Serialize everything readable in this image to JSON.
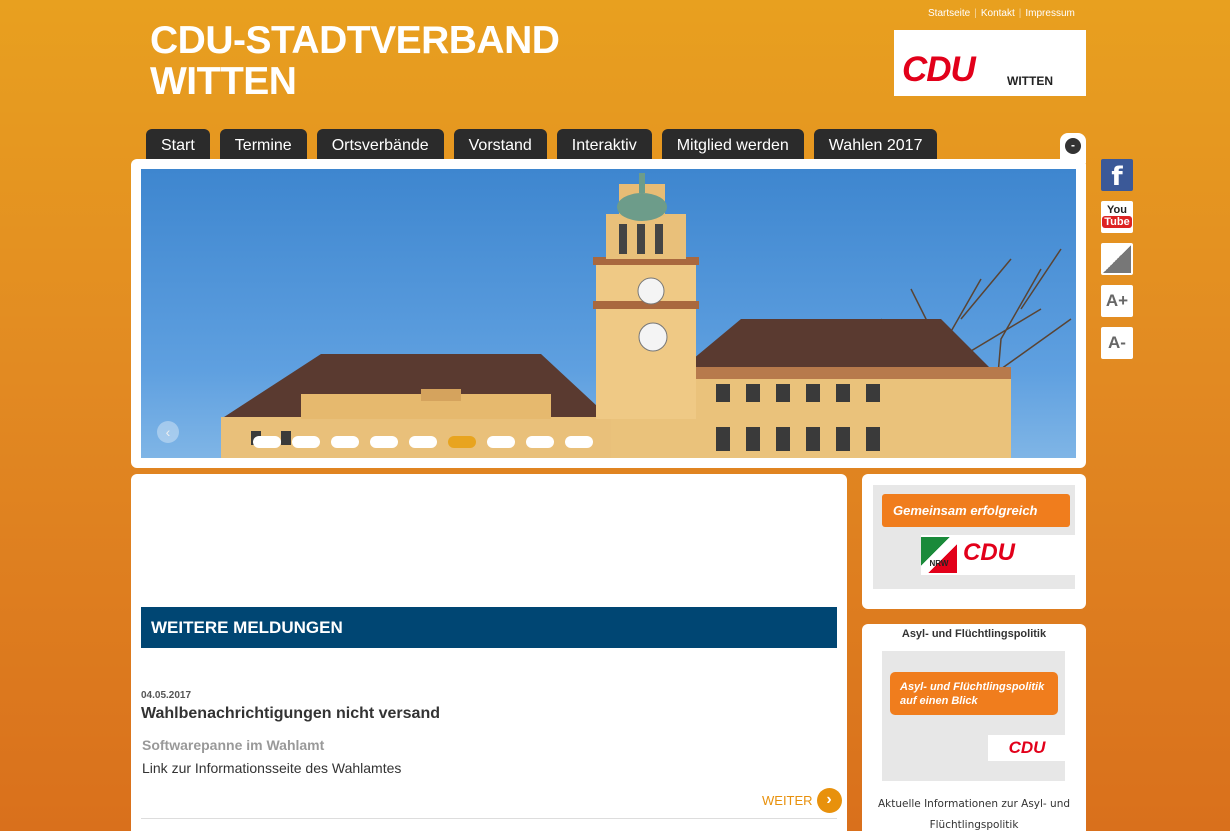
{
  "header": {
    "top_links": [
      "Startseite",
      "Kontakt",
      "Impressum"
    ],
    "title_line1": "CDU-STADTVERBAND",
    "title_line2": "WITTEN",
    "logo_text": "CDU",
    "logo_city": "WITTEN"
  },
  "nav": {
    "items": [
      "Start",
      "Termine",
      "Ortsverbände",
      "Vorstand",
      "Interaktiv",
      "Mitglied werden",
      "Wahlen 2017"
    ],
    "collapse_symbol": "-"
  },
  "slider": {
    "prev_symbol": "‹",
    "slide_count": 9,
    "active_index": 5
  },
  "social": {
    "facebook_label": "f",
    "youtube_you": "You",
    "youtube_tube": "Tube",
    "font_increase": "A+",
    "font_decrease": "A-"
  },
  "main": {
    "section_title": "WEITERE MELDUNGEN",
    "news": {
      "date": "04.05.2017",
      "title": "Wahlbenachrichtigungen nicht versand",
      "subtitle": "Softwarepanne im Wahlamt",
      "text": "Link zur Informationsseite des Wahlamtes",
      "more_label": "WEITER",
      "more_symbol": "›"
    }
  },
  "sidebar": {
    "box1": {
      "slogan": "Gemeinsam erfolgreich",
      "nrw_label": "NRW",
      "cdu": "CDU"
    },
    "box2": {
      "heading": "Asyl- und Flüchtlingspolitik",
      "banner_line1": "Asyl- und Flüchtlingspolitik",
      "banner_line2": "auf einen Blick",
      "cdu": "CDU",
      "desc_line1": "Aktuelle Informationen zur Asyl- und",
      "desc_line2": "Flüchtlingspolitik"
    }
  },
  "colors": {
    "background": "#e39222",
    "section_blue": "#004673",
    "accent_orange": "#e8910c",
    "cdu_red": "#e2001a",
    "nav_dark": "#2b2b2b"
  }
}
